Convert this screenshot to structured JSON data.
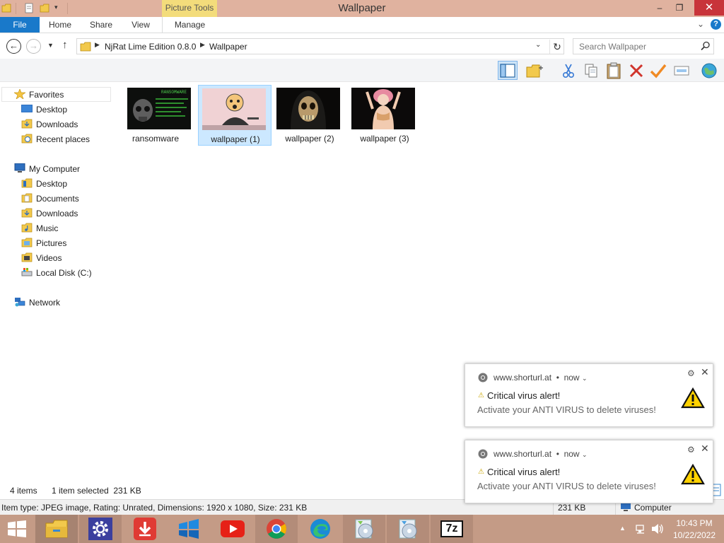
{
  "window": {
    "title": "Wallpaper",
    "context_tab": "Picture Tools",
    "controls": {
      "minimize": "–",
      "maximize": "❐",
      "close": "✕"
    }
  },
  "ribbon": {
    "tabs": [
      "File",
      "Home",
      "Share",
      "View",
      "Manage"
    ],
    "collapse": "⌄",
    "help": "?"
  },
  "address": {
    "breadcrumb": [
      "NjRat Lime Edition 0.8.0",
      "Wallpaper"
    ],
    "search_placeholder": "Search Wallpaper"
  },
  "toolbar": {
    "icons": [
      "preview-pane-icon",
      "new-folder-icon",
      "cut-icon",
      "copy-icon",
      "paste-icon",
      "delete-icon",
      "check-icon",
      "rename-icon",
      "globe-icon"
    ]
  },
  "navpane": {
    "favorites": {
      "label": "Favorites",
      "items": [
        "Desktop",
        "Downloads",
        "Recent places"
      ]
    },
    "computer": {
      "label": "My Computer",
      "items": [
        "Desktop",
        "Documents",
        "Downloads",
        "Music",
        "Pictures",
        "Videos",
        "Local Disk (C:)"
      ]
    },
    "network": {
      "label": "Network"
    }
  },
  "files": [
    {
      "name": "ransomware",
      "thumb_text": "RANSOMWARE",
      "selected": false
    },
    {
      "name": "wallpaper (1)",
      "selected": true
    },
    {
      "name": "wallpaper (2)",
      "selected": false
    },
    {
      "name": "wallpaper (3)",
      "selected": false
    }
  ],
  "status": {
    "item_count": "4 items",
    "selection": "1 item selected  231 KB"
  },
  "details": {
    "info": "Item type: JPEG image, Rating: Unrated, Dimensions: 1920 x 1080, Size: 231 KB",
    "size": "231 KB",
    "location": "Computer"
  },
  "notifications": [
    {
      "source": "www.shorturl.at",
      "time": "now",
      "title": "Critical virus alert!",
      "body": "Activate your ANTI VIRUS to delete viruses!"
    },
    {
      "source": "www.shorturl.at",
      "time": "now",
      "title": "Critical virus alert!",
      "body": "Activate your ANTI VIRUS to delete viruses!"
    }
  ],
  "taskbar": {
    "apps": [
      "file-explorer",
      "settings",
      "downloader",
      "windows",
      "youtube",
      "chrome",
      "edge",
      "disc-tool-1",
      "disc-tool-2",
      "7zip"
    ],
    "sevenzip_label": "7z",
    "time": "10:43 PM",
    "date": "10/22/2022"
  },
  "colors": {
    "titlebar": "#e0b29f",
    "accent": "#1979ca",
    "picture_tools": "#f3dc7b",
    "taskbar": "#c49b86",
    "selection": "#cce8ff"
  }
}
